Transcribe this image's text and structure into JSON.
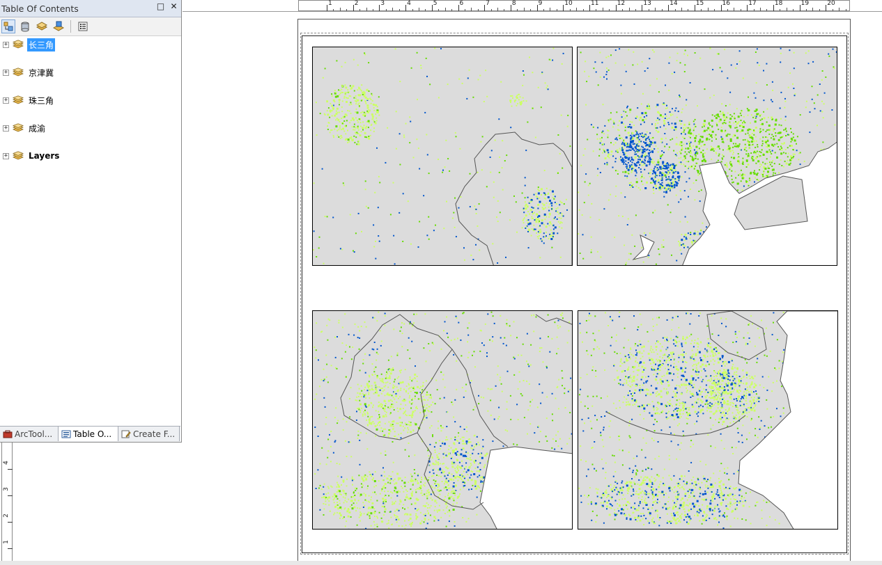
{
  "toc": {
    "title": "Table Of Contents",
    "close_glyph": "✕",
    "restore_glyph": "□",
    "toolbar": [
      {
        "icon": "list-by-drawing-order-icon",
        "active": true
      },
      {
        "icon": "list-by-source-icon",
        "active": false
      },
      {
        "icon": "list-by-visibility-icon",
        "active": false
      },
      {
        "icon": "list-by-selection-icon",
        "active": false
      },
      {
        "icon": "options-icon",
        "active": false
      }
    ],
    "layers": [
      {
        "label": "长三角",
        "selected": true,
        "bold": false
      },
      {
        "label": "京津冀",
        "selected": false,
        "bold": false
      },
      {
        "label": "珠三角",
        "selected": false,
        "bold": false
      },
      {
        "label": "成渝",
        "selected": false,
        "bold": false
      },
      {
        "label": "Layers",
        "selected": false,
        "bold": true
      }
    ],
    "tabs": [
      {
        "label": "ArcTool...",
        "icon": "arctoolbox-icon",
        "active": false
      },
      {
        "label": "Table O...",
        "icon": "table-of-contents-icon",
        "active": true
      },
      {
        "label": "Create F...",
        "icon": "create-features-icon",
        "active": false
      }
    ],
    "expander_glyph": "+"
  },
  "rulers": {
    "horizontal": [
      "1",
      "2",
      "3",
      "4",
      "5",
      "6",
      "7",
      "8",
      "9",
      "10",
      "11",
      "12",
      "13",
      "14",
      "15",
      "16",
      "17",
      "18",
      "19",
      "20"
    ],
    "vertical": [
      "4",
      "3",
      "2",
      "1"
    ]
  },
  "colors": {
    "land": "#dcdcdc",
    "light_green": "#ccff66",
    "green": "#66dd00",
    "blue": "#0055cc",
    "sea": "#ffffff",
    "boundary": "#555555"
  },
  "map_frames": [
    {
      "name": "map-frame-top-left"
    },
    {
      "name": "map-frame-top-right"
    },
    {
      "name": "map-frame-bottom-left"
    },
    {
      "name": "map-frame-bottom-right"
    }
  ]
}
